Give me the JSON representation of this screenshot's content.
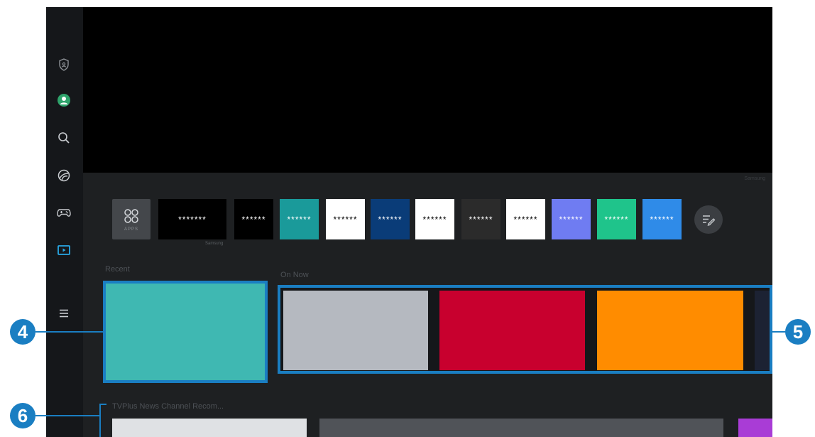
{
  "sidebar": {
    "items": [
      {
        "name": "privacy-icon",
        "active": false
      },
      {
        "name": "profile-icon",
        "active": false
      },
      {
        "name": "search-icon",
        "active": false
      },
      {
        "name": "ambient-icon",
        "active": false
      },
      {
        "name": "game-icon",
        "active": false
      },
      {
        "name": "media-icon",
        "active": true
      },
      {
        "name": "menu-icon",
        "active": false
      }
    ]
  },
  "hero": {
    "tag": "Samsung"
  },
  "apps_row": {
    "apps_button_label": "APPS",
    "apps_sublabel": "Samsung",
    "apps": [
      {
        "label": "*******",
        "color": "#000000",
        "text": "#ffffff"
      },
      {
        "label": "******",
        "color": "#000000",
        "text": "#ffffff"
      },
      {
        "label": "******",
        "color": "#1a9a9a",
        "text": "#ffffff"
      },
      {
        "label": "******",
        "color": "#ffffff",
        "text": "#000000"
      },
      {
        "label": "******",
        "color": "#0a3c78",
        "text": "#ffffff"
      },
      {
        "label": "******",
        "color": "#ffffff",
        "text": "#000000"
      },
      {
        "label": "******",
        "color": "#2b2b2b",
        "text": "#ffffff"
      },
      {
        "label": "******",
        "color": "#ffffff",
        "text": "#000000"
      },
      {
        "label": "******",
        "color": "#6f7cf2",
        "text": "#ffffff"
      },
      {
        "label": "******",
        "color": "#1fc48b",
        "text": "#ffffff"
      },
      {
        "label": "******",
        "color": "#2f8be8",
        "text": "#ffffff"
      }
    ]
  },
  "recent": {
    "title": "Recent",
    "card_color": "#3fb8b2"
  },
  "on_now": {
    "title": "On Now",
    "tiles": [
      {
        "color": "#b5b9c0"
      },
      {
        "color": "#c8002e"
      },
      {
        "color": "#ff8c00"
      }
    ]
  },
  "news_row": {
    "title": "TVPlus News Channel Recom..."
  },
  "callouts": {
    "four": "4",
    "five": "5",
    "six": "6"
  },
  "colors": {
    "accent": "#1a7ec2",
    "profile": "#2ea36b"
  }
}
